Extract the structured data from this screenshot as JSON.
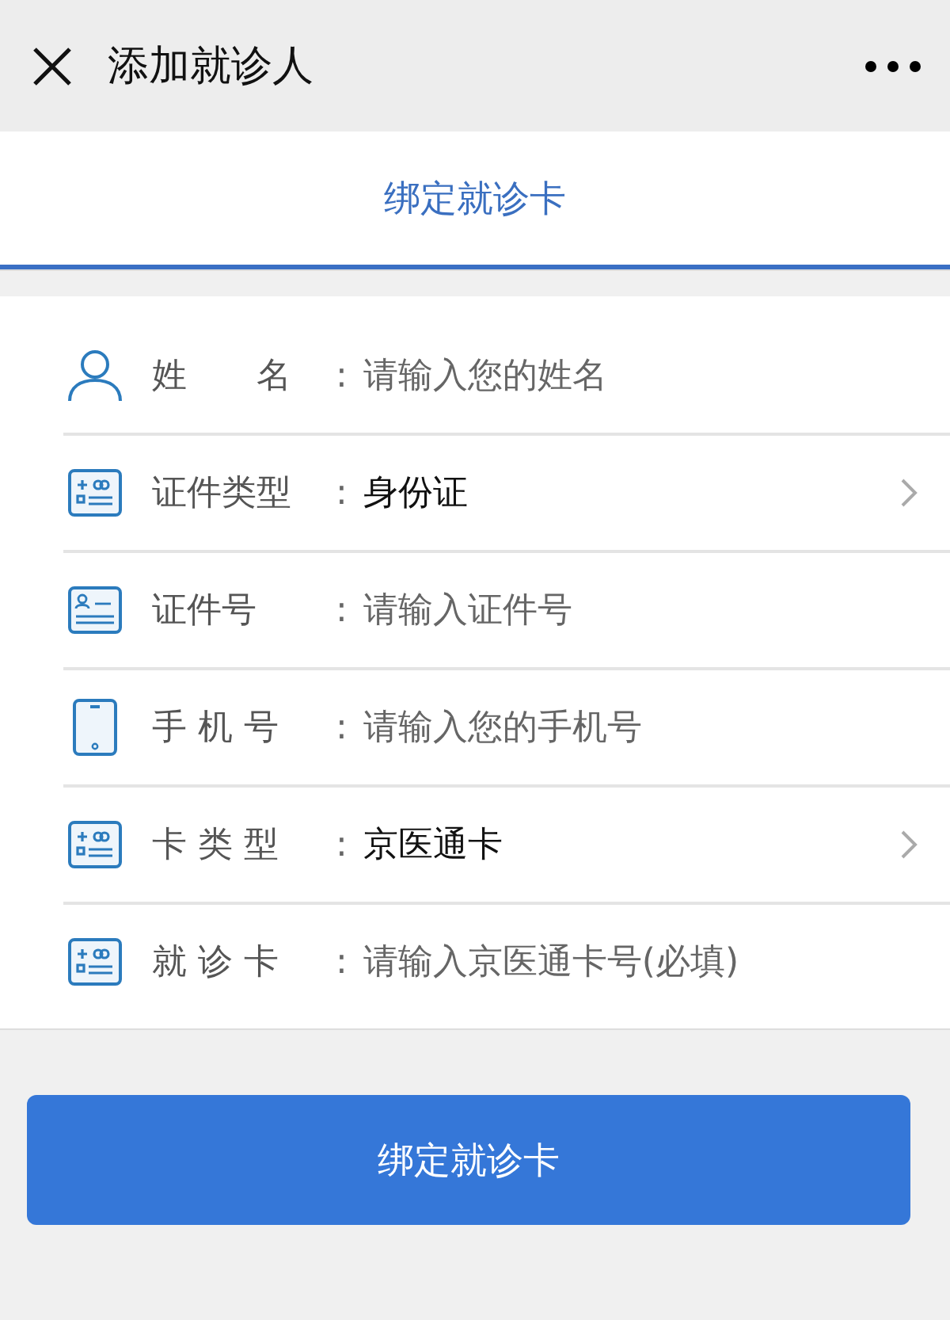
{
  "top_bar": {
    "title": "添加就诊人"
  },
  "tab": {
    "label": "绑定就诊卡",
    "selected": true
  },
  "form": {
    "rows": [
      {
        "kind": "input",
        "label": "姓　　名",
        "colon": ":",
        "placeholder": "请输入您的姓名"
      },
      {
        "kind": "select",
        "label": "证件类型",
        "colon": ":",
        "value": "身份证"
      },
      {
        "kind": "input",
        "label": "证件号",
        "colon": ":",
        "placeholder": "请输入证件号"
      },
      {
        "kind": "input",
        "label": "手 机 号",
        "colon": ":",
        "placeholder": "请输入您的手机号"
      },
      {
        "kind": "select",
        "label": "卡 类 型",
        "colon": ":",
        "value": "京医通卡"
      },
      {
        "kind": "input",
        "label": "就 诊 卡",
        "colon": ":",
        "placeholder": "请输入京医通卡号(必填)"
      }
    ]
  },
  "submit_button": "绑定就诊卡"
}
